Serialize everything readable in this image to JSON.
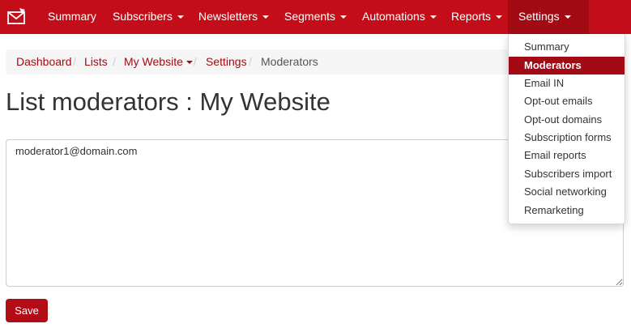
{
  "colors": {
    "brand": "#c30e1a",
    "active_nav": "#a30b14",
    "link": "#a30b14",
    "button": "#b30c17"
  },
  "nav": {
    "logo_icon": "envelope-icon",
    "items": [
      {
        "label": "Summary",
        "has_caret": false
      },
      {
        "label": "Subscribers",
        "has_caret": true
      },
      {
        "label": "Newsletters",
        "has_caret": true
      },
      {
        "label": "Segments",
        "has_caret": true
      },
      {
        "label": "Automations",
        "has_caret": true
      },
      {
        "label": "Reports",
        "has_caret": true
      },
      {
        "label": "Settings",
        "has_caret": true,
        "active": true
      }
    ]
  },
  "breadcrumb": {
    "items": [
      "Dashboard",
      "Lists",
      "My Website",
      "Settings",
      "Moderators"
    ],
    "separator": "/"
  },
  "page": {
    "title": "List moderators : My Website"
  },
  "form": {
    "moderators_value": "moderator1@domain.com",
    "save_label": "Save"
  },
  "settings_menu": {
    "items": [
      {
        "label": "Summary",
        "active": false
      },
      {
        "label": "Moderators",
        "active": true
      },
      {
        "label": "Email IN",
        "active": false
      },
      {
        "label": "Opt-out emails",
        "active": false
      },
      {
        "label": "Opt-out domains",
        "active": false
      },
      {
        "label": "Subscription forms",
        "active": false
      },
      {
        "label": "Email reports",
        "active": false
      },
      {
        "label": "Subscribers import",
        "active": false
      },
      {
        "label": "Social networking",
        "active": false
      },
      {
        "label": "Remarketing",
        "active": false
      }
    ]
  }
}
